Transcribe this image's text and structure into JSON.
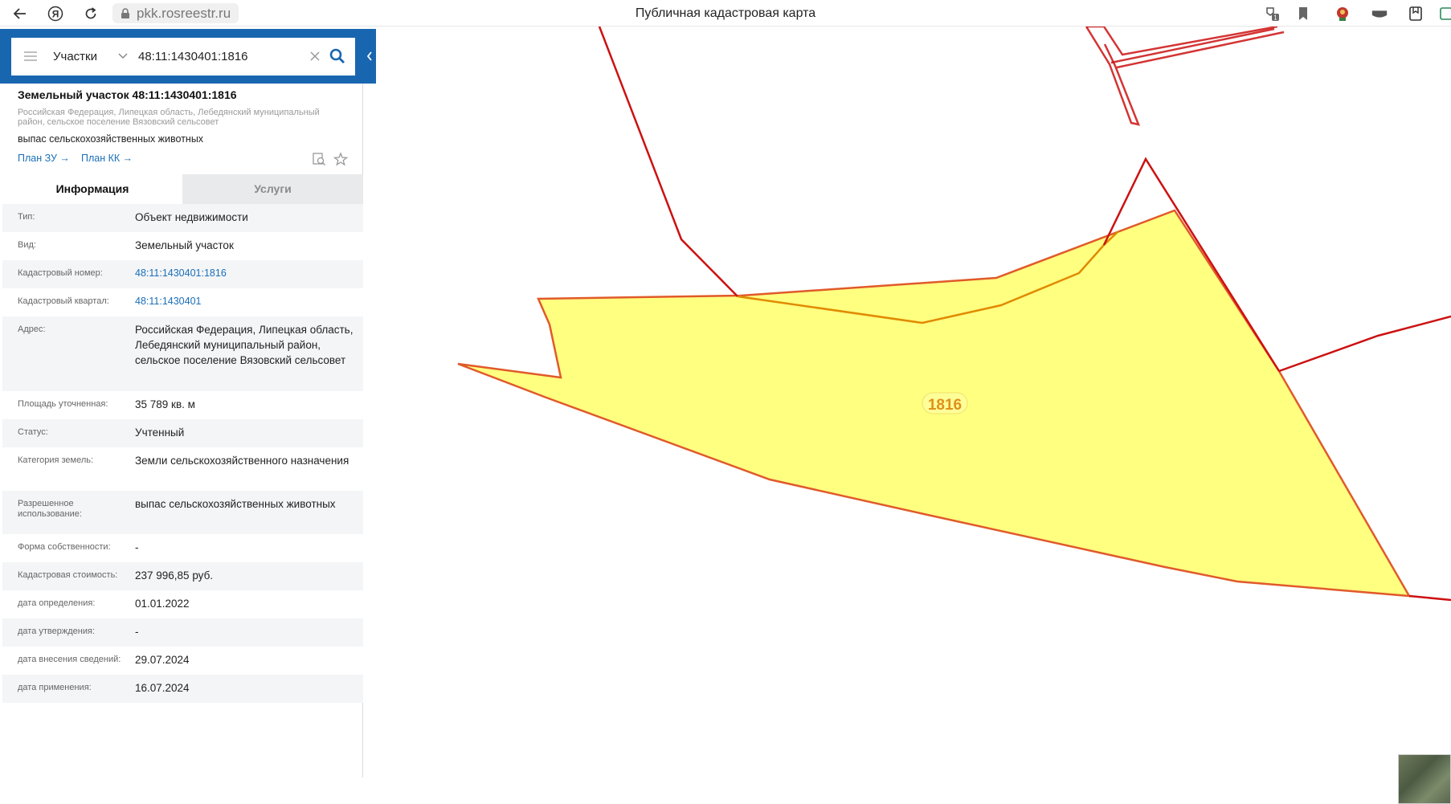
{
  "browser": {
    "url": "pkk.rosreestr.ru",
    "title": "Публичная кадастровая карта",
    "badge_count": "1"
  },
  "search": {
    "type_selected": "Участки",
    "query": "48:11:1430401:1816"
  },
  "object": {
    "title": "Земельный участок 48:11:1430401:1816",
    "address": "Российская Федерация, Липецкая область, Лебедянский муниципальный район, сельское поселение Вязовский сельсовет",
    "usage": "выпас сельскохозяйственных животных",
    "link_plan_zu": "План ЗУ →",
    "link_plan_kk": "План КК →"
  },
  "tabs": {
    "info": "Информация",
    "services": "Услуги"
  },
  "info_rows": [
    {
      "label": "Тип:",
      "value": "Объект недвижимости"
    },
    {
      "label": "Вид:",
      "value": "Земельный участок"
    },
    {
      "label": "Кадастровый номер:",
      "value": "48:11:1430401:1816"
    },
    {
      "label": "Кадастровый квартал:",
      "value": "48:11:1430401"
    },
    {
      "label": "Адрес:",
      "value": "Российская Федерация, Липецкая область, Лебедянский муниципальный район, сельское поселение Вязовский сельсовет"
    },
    {
      "label": "Площадь уточненная:",
      "value": "35 789 кв. м"
    },
    {
      "label": "Статус:",
      "value": "Учтенный"
    },
    {
      "label": "Категория земель:",
      "value": "Земли сельскохозяйственного назначения"
    },
    {
      "label": "Разрешенное использование:",
      "value": "выпас сельскохозяйственных животных"
    },
    {
      "label": "Форма собственности:",
      "value": "-"
    },
    {
      "label": "Кадастровая стоимость:",
      "value": "237 996,85 руб."
    },
    {
      "label": "дата определения:",
      "value": "01.01.2022"
    },
    {
      "label": "дата утверждения:",
      "value": "-"
    },
    {
      "label": "дата внесения сведений:",
      "value": "29.07.2024"
    },
    {
      "label": "дата применения:",
      "value": "16.07.2024"
    }
  ],
  "map": {
    "parcel_label": "1816",
    "parcel_fill": "#ffff80",
    "parcel_stroke": "#e05a2a",
    "boundary_color": "#cc1111",
    "highlight_color": "#e08a00"
  }
}
